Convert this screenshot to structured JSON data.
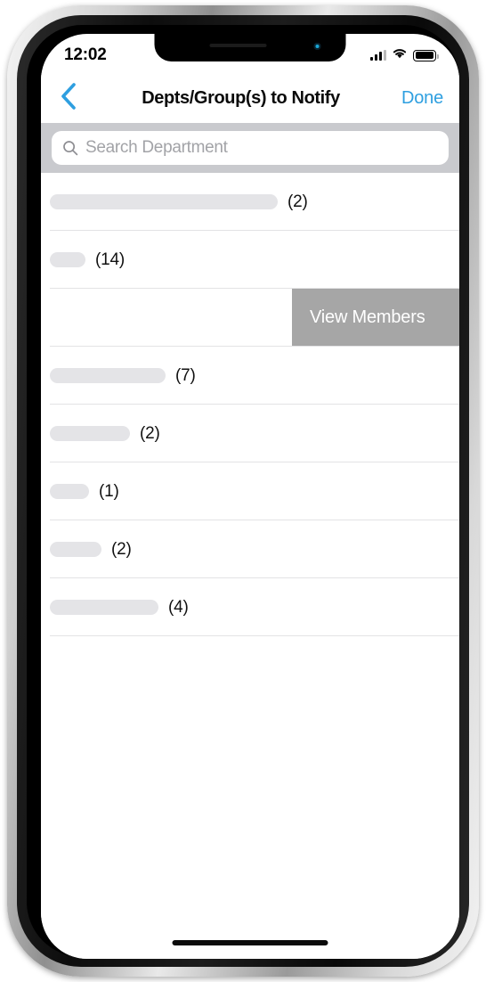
{
  "status_bar": {
    "time": "12:02",
    "cellular_icon": "cellular-signal-icon",
    "wifi_icon": "wifi-icon",
    "battery_icon": "battery-icon"
  },
  "nav_bar": {
    "back_icon": "chevron-left-icon",
    "title": "Depts/Group(s) to Notify",
    "done_label": "Done",
    "accent_color": "#2e9fe0"
  },
  "search": {
    "icon": "search-icon",
    "placeholder": "Search Department",
    "value": "",
    "band_color": "#c9cace"
  },
  "list": {
    "rows": [
      {
        "name_redacted": true,
        "pill_width": 256,
        "count": "(2)",
        "swiped": false
      },
      {
        "name_redacted": true,
        "pill_width": 40,
        "count": "(14)",
        "swiped": false
      },
      {
        "name_redacted": true,
        "pill_width": 0,
        "count": "",
        "swiped": true,
        "action_label": "View Members"
      },
      {
        "name_redacted": true,
        "pill_width": 130,
        "count": "(7)",
        "swiped": false
      },
      {
        "name_redacted": true,
        "pill_width": 90,
        "count": "(2)",
        "swiped": false
      },
      {
        "name_redacted": true,
        "pill_width": 44,
        "count": "(1)",
        "swiped": false
      },
      {
        "name_redacted": true,
        "pill_width": 58,
        "count": "(2)",
        "swiped": false
      },
      {
        "name_redacted": true,
        "pill_width": 122,
        "count": "(4)",
        "swiped": false
      }
    ],
    "swipe_action_color": "#a6a6a6",
    "separator_color": "#e3e3e5",
    "redaction_color": "#e4e4e7"
  },
  "home_indicator": "home-indicator"
}
